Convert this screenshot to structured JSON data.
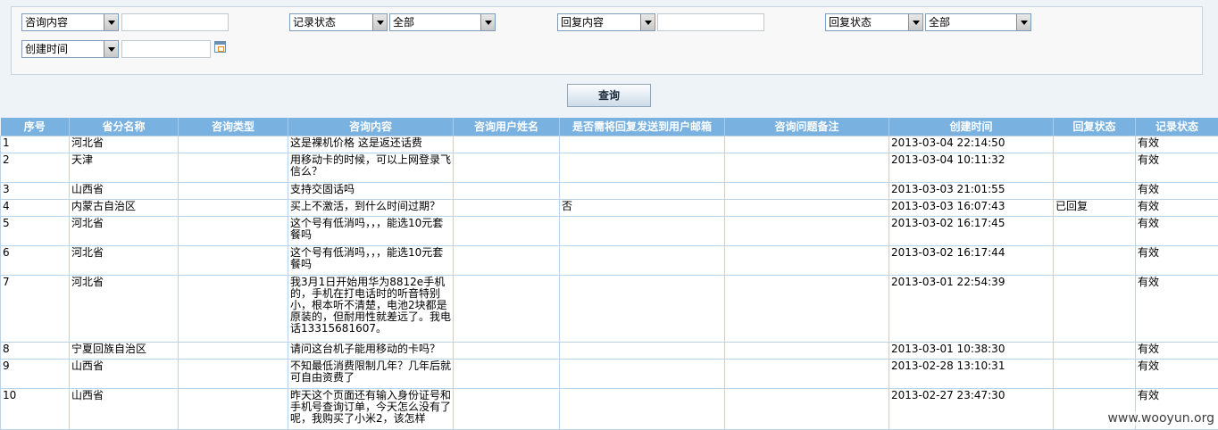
{
  "filters": {
    "consult_content": {
      "label": "咨询内容",
      "value": ""
    },
    "record_status": {
      "label": "记录状态",
      "value": "全部"
    },
    "reply_content": {
      "label": "回复内容",
      "value": ""
    },
    "reply_status": {
      "label": "回复状态",
      "value": "全部"
    },
    "create_time": {
      "label": "创建时间",
      "value": ""
    }
  },
  "query_button": "查询",
  "table": {
    "headers": [
      "序号",
      "省分名称",
      "咨询类型",
      "咨询内容",
      "咨询用户姓名",
      "是否需将回复发送到用户邮箱",
      "咨询问题备注",
      "创建时间",
      "回复状态",
      "记录状态"
    ],
    "rows": [
      {
        "no": "1",
        "province": "河北省",
        "type": "",
        "content": "这是裸机价格 这是返还话费",
        "send_email": "",
        "note": "",
        "created": "2013-03-04 22:14:50",
        "reply_status": "",
        "record_status": "有效"
      },
      {
        "no": "2",
        "province": "天津",
        "type": "",
        "content": "用移动卡的时候，可以上网登录飞信么？",
        "send_email": "",
        "note": "",
        "created": "2013-03-04 10:11:32",
        "reply_status": "",
        "record_status": "有效"
      },
      {
        "no": "3",
        "province": "山西省",
        "type": "",
        "content": "支持交固话吗",
        "send_email": "",
        "note": "",
        "created": "2013-03-03 21:01:55",
        "reply_status": "",
        "record_status": "有效"
      },
      {
        "no": "4",
        "province": "内蒙古自治区",
        "type": "",
        "content": "买上不激活，到什么时间过期？",
        "send_email": "否",
        "note": "",
        "created": "2013-03-03 16:07:43",
        "reply_status": "已回复",
        "record_status": "有效"
      },
      {
        "no": "5",
        "province": "河北省",
        "type": "",
        "content": "这个号有低消吗，，，能选10元套餐吗",
        "send_email": "",
        "note": "",
        "created": "2013-03-02 16:17:45",
        "reply_status": "",
        "record_status": "有效"
      },
      {
        "no": "6",
        "province": "河北省",
        "type": "",
        "content": "这个号有低消吗，，，能选10元套餐吗",
        "send_email": "",
        "note": "",
        "created": "2013-03-02 16:17:44",
        "reply_status": "",
        "record_status": "有效"
      },
      {
        "no": "7",
        "province": "河北省",
        "type": "",
        "content": "我3月1日开始用华为8812e手机的，手机在打电话时的听音特别小，根本听不清楚，电池2块都是原装的，但耐用性就差远了。我电话13315681607。",
        "send_email": "",
        "note": "",
        "created": "2013-03-01 22:54:39",
        "reply_status": "",
        "record_status": "有效"
      },
      {
        "no": "8",
        "province": "宁夏回族自治区",
        "type": "",
        "content": "请问这台机子能用移动的卡吗？",
        "send_email": "",
        "note": "",
        "created": "2013-03-01 10:38:30",
        "reply_status": "",
        "record_status": "有效"
      },
      {
        "no": "9",
        "province": "山西省",
        "type": "",
        "content": "不知最低消费限制几年？几年后就可自由资费了",
        "send_email": "",
        "note": "",
        "created": "2013-02-28 13:10:31",
        "reply_status": "",
        "record_status": "有效"
      },
      {
        "no": "10",
        "province": "山西省",
        "type": "",
        "content": "昨天这个页面还有输入身份证号和手机号查询订单，今天怎么没有了呢，我购买了小米2，该怎样",
        "send_email": "",
        "note": "",
        "created": "2013-02-27 23:47:30",
        "reply_status": "",
        "record_status": "有效"
      }
    ]
  },
  "watermark": "www.wooyun.org"
}
